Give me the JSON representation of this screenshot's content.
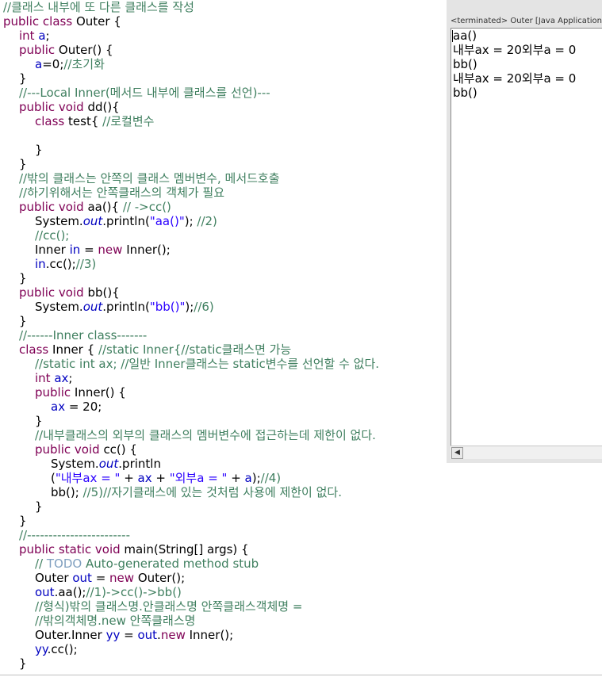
{
  "editor": {
    "lines": [
      "//클래스 내부에 또 다른 클래스를 작성",
      "public class Outer {",
      "int a;",
      "public Outer() {",
      "a=0;//초기화",
      "}",
      "//---Local Inner(메서드 내부에 클래스를 선언)---",
      "public void dd(){",
      "class test{ //로컬변수",
      "",
      "}",
      "}",
      "//밖의 클래스는 안쪽의 클래스 멤버변수, 메서드호출",
      "//하기위해서는 안쪽클래스의 객체가 필요",
      "public void aa(){ // ->cc()",
      "System.out.println(\"aa()\"); //2)",
      "//cc();",
      "Inner in = new Inner();",
      "in.cc();//3)",
      "}",
      "public void bb(){",
      "System.out.println(\"bb()\");//6)",
      "}",
      "//------Inner class-------",
      "class Inner { //static Inner{//static클래스면 가능",
      "//static int ax; //일반 Inner클래스는 static변수를 선언할 수 없다.",
      "int ax;",
      "public Inner() {",
      "ax = 20;",
      "}",
      "//내부클래스의 외부의 클래스의 멤버변수에 접근하는데 제한이 없다.",
      "public void cc() {",
      "System.out.println",
      "(\"내부ax = \" + ax + \"외부a = \" + a);//4)",
      "bb(); //5)//자기클래스에 있는 것처럼 사용에 제한이 없다.",
      "}",
      "}",
      "//------------------------",
      "public static void main(String[] args) {",
      "// TODO Auto-generated method stub",
      "Outer out = new Outer();",
      "out.aa();//1)->cc()->bb()",
      "//형식)밖의 클래스명.안클래스명 안쪽클래스객체명 =",
      "//밖의객체명.new 안쪽클래스명",
      "Outer.Inner yy = out.new Inner();",
      "yy.cc();",
      "}"
    ]
  },
  "console": {
    "header": "<terminated> Outer [Java Application]",
    "lines": [
      "aa()",
      "내부ax = 20외부a = 0",
      "bb()",
      "내부ax = 20외부a = 0",
      "bb()"
    ]
  },
  "colors": {
    "keyword": "#7f0055",
    "comment": "#3f7f5f",
    "string": "#2a00ff",
    "field": "#0000c0",
    "todo": "#7f9fbf",
    "console_bg": "#e4e4e4"
  }
}
